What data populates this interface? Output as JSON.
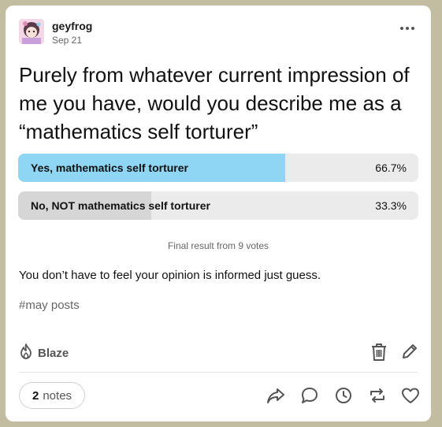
{
  "post": {
    "username": "geyfrog",
    "date": "Sep 21",
    "question": "Purely from whatever current impression of me you have, would you describe me as a “mathematics self torturer”",
    "body": "You don’t have to feel your opinion is informed just guess.",
    "tag": "#may posts"
  },
  "poll": {
    "options": [
      {
        "label": "Yes, mathematics self torturer",
        "percent_text": "66.7%",
        "fraction": 0.667,
        "fill_color": "#8ed6f4"
      },
      {
        "label": "No, NOT mathematics self torturer",
        "percent_text": "33.3%",
        "fraction": 0.333,
        "fill_color": "#d6d6d6"
      }
    ],
    "final_text": "Final result from 9 votes"
  },
  "footer": {
    "blaze_label": "Blaze",
    "notes_count": "2",
    "notes_label": "notes"
  },
  "icons": {
    "more": "more-options-icon",
    "blaze": "flame-icon",
    "delete": "trash-icon",
    "edit": "pencil-icon",
    "share": "share-icon",
    "reply": "reply-icon",
    "queue": "clock-icon",
    "reblog": "reblog-icon",
    "like": "heart-icon"
  }
}
